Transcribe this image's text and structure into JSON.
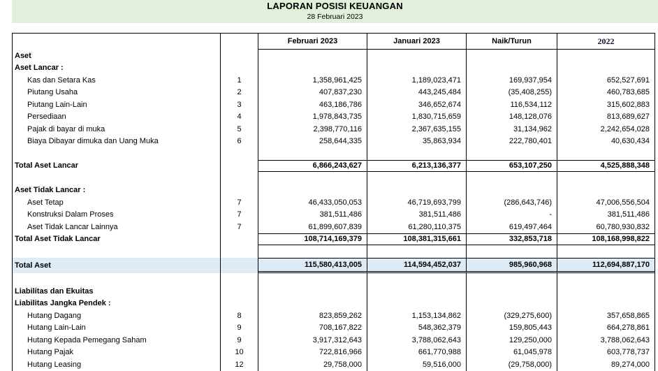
{
  "header": {
    "title": "LAPORAN POSISI KEUANGAN",
    "date": "28 Februari 2023"
  },
  "colors": {
    "header_band_green": "#e2efda",
    "total_aset_highlight_blue": "#ddebf7",
    "border_black": "#000000"
  },
  "table": {
    "columns": [
      "Februari 2023",
      "Januari 2023",
      "Naik/Turun",
      "2022"
    ],
    "rows": [
      {
        "type": "section",
        "label": "Aset",
        "note": "",
        "feb": "",
        "jan": "",
        "change": "",
        "y2022": ""
      },
      {
        "type": "section",
        "label": "Aset Lancar :",
        "note": "",
        "feb": "",
        "jan": "",
        "change": "",
        "y2022": ""
      },
      {
        "type": "detail",
        "label": "Kas dan Setara Kas",
        "note": "1",
        "feb": "1,358,961,425",
        "jan": "1,189,023,471",
        "change": "169,937,954",
        "y2022": "652,527,691"
      },
      {
        "type": "detail",
        "label": "Piutang Usaha",
        "note": "2",
        "feb": "407,837,230",
        "jan": "443,245,484",
        "change": "(35,408,255)",
        "y2022": "460,783,685"
      },
      {
        "type": "detail",
        "label": "Piutang Lain-Lain",
        "note": "3",
        "feb": "463,186,786",
        "jan": "346,652,674",
        "change": "116,534,112",
        "y2022": "315,602,883"
      },
      {
        "type": "detail",
        "label": "Persediaan",
        "note": "4",
        "feb": "1,978,843,735",
        "jan": "1,830,715,659",
        "change": "148,128,076",
        "y2022": "813,689,627"
      },
      {
        "type": "detail",
        "label": "Pajak di bayar di muka",
        "note": "5",
        "feb": "2,398,770,116",
        "jan": "2,367,635,155",
        "change": "31,134,962",
        "y2022": "2,242,654,028"
      },
      {
        "type": "detail",
        "label": "Biaya Dibayar dimuka dan Uang Muka",
        "note": "6",
        "feb": "258,644,335",
        "jan": "35,863,934",
        "change": "222,780,401",
        "y2022": "40,630,434"
      },
      {
        "type": "blank",
        "label": "",
        "note": "",
        "feb": "",
        "jan": "",
        "change": "",
        "y2022": ""
      },
      {
        "type": "total",
        "label": "Total Aset Lancar",
        "note": "",
        "feb": "6,866,243,627",
        "jan": "6,213,136,377",
        "change": "653,107,250",
        "y2022": "4,525,888,348"
      },
      {
        "type": "blank",
        "label": "",
        "note": "",
        "feb": "",
        "jan": "",
        "change": "",
        "y2022": ""
      },
      {
        "type": "section",
        "label": "Aset Tidak Lancar :",
        "note": "",
        "feb": "",
        "jan": "",
        "change": "",
        "y2022": ""
      },
      {
        "type": "detail",
        "label": "Aset Tetap",
        "note": "7",
        "feb": "46,433,050,053",
        "jan": "46,719,693,799",
        "change": "(286,643,746)",
        "y2022": "47,006,556,504"
      },
      {
        "type": "detail",
        "label": "Konstruksi Dalam Proses",
        "note": "7",
        "feb": "381,511,486",
        "jan": "381,511,486",
        "change": "-",
        "y2022": "381,511,486"
      },
      {
        "type": "detail",
        "label": "Aset Tidak Lancar Lainnya",
        "note": "7",
        "feb": "61,899,607,839",
        "jan": "61,280,110,375",
        "change": "619,497,464",
        "y2022": "60,780,930,832"
      },
      {
        "type": "total",
        "label": "Total Aset Tidak Lancar",
        "note": "",
        "feb": "108,714,169,379",
        "jan": "108,381,315,661",
        "change": "332,853,718",
        "y2022": "108,168,998,822"
      },
      {
        "type": "blank",
        "label": "",
        "note": "",
        "feb": "",
        "jan": "",
        "change": "",
        "y2022": ""
      },
      {
        "type": "grand",
        "label": "Total Aset",
        "note": "",
        "feb": "115,580,413,005",
        "jan": "114,594,452,037",
        "change": "985,960,968",
        "y2022": "112,694,887,170"
      },
      {
        "type": "blank",
        "label": "",
        "note": "",
        "feb": "",
        "jan": "",
        "change": "",
        "y2022": ""
      },
      {
        "type": "section",
        "label": "Liabilitas dan Ekuitas",
        "note": "",
        "feb": "",
        "jan": "",
        "change": "",
        "y2022": ""
      },
      {
        "type": "section",
        "label": "Liabilitas Jangka Pendek :",
        "note": "",
        "feb": "",
        "jan": "",
        "change": "",
        "y2022": ""
      },
      {
        "type": "detail",
        "label": "Hutang Dagang",
        "note": "8",
        "feb": "823,859,262",
        "jan": "1,153,134,862",
        "change": "(329,275,600)",
        "y2022": "357,658,865"
      },
      {
        "type": "detail",
        "label": "Hutang Lain-Lain",
        "note": "9",
        "feb": "708,167,822",
        "jan": "548,362,379",
        "change": "159,805,443",
        "y2022": "664,278,861"
      },
      {
        "type": "detail",
        "label": "Hutang Kepada Pemegang Saham",
        "note": "9",
        "feb": "3,917,312,643",
        "jan": "3,788,062,643",
        "change": "129,250,000",
        "y2022": "3,788,062,643"
      },
      {
        "type": "detail",
        "label": "Hutang Pajak",
        "note": "10",
        "feb": "722,816,966",
        "jan": "661,770,988",
        "change": "61,045,978",
        "y2022": "603,778,737"
      },
      {
        "type": "detail",
        "label": "Hutang Leasing",
        "note": "12",
        "feb": "29,758,000",
        "jan": "59,516,000",
        "change": "(29,758,000)",
        "y2022": "89,274,000"
      }
    ]
  }
}
